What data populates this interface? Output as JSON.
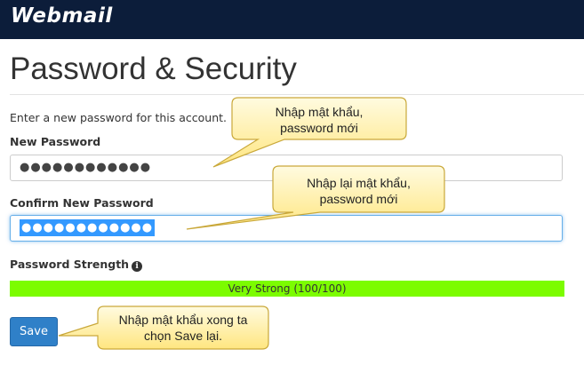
{
  "header": {
    "logo_text": "Webmail"
  },
  "page": {
    "title": "Password & Security",
    "intro": "Enter a new password for this account."
  },
  "form": {
    "new_password_label": "New Password",
    "new_password_value": "●●●●●●●●●●●●",
    "confirm_password_label": "Confirm New Password",
    "confirm_password_value": "●●●●●●●●●●●●",
    "strength_label": "Password Strength",
    "strength_text": "Very Strong (100/100)",
    "strength_percent": 100,
    "save_label": "Save"
  },
  "callouts": {
    "c1": [
      "Nhập mật khẩu,",
      "password mới"
    ],
    "c2": [
      "Nhập lại mật khẩu,",
      "password mới"
    ],
    "c3": [
      "Nhập mật khẩu xong ta",
      "chọn Save lại."
    ]
  },
  "colors": {
    "header_bg": "#0c1d3a",
    "strength_fill": "#7cfc00",
    "button_bg": "#2f80c8",
    "callout_fill": "#fff4b0"
  }
}
